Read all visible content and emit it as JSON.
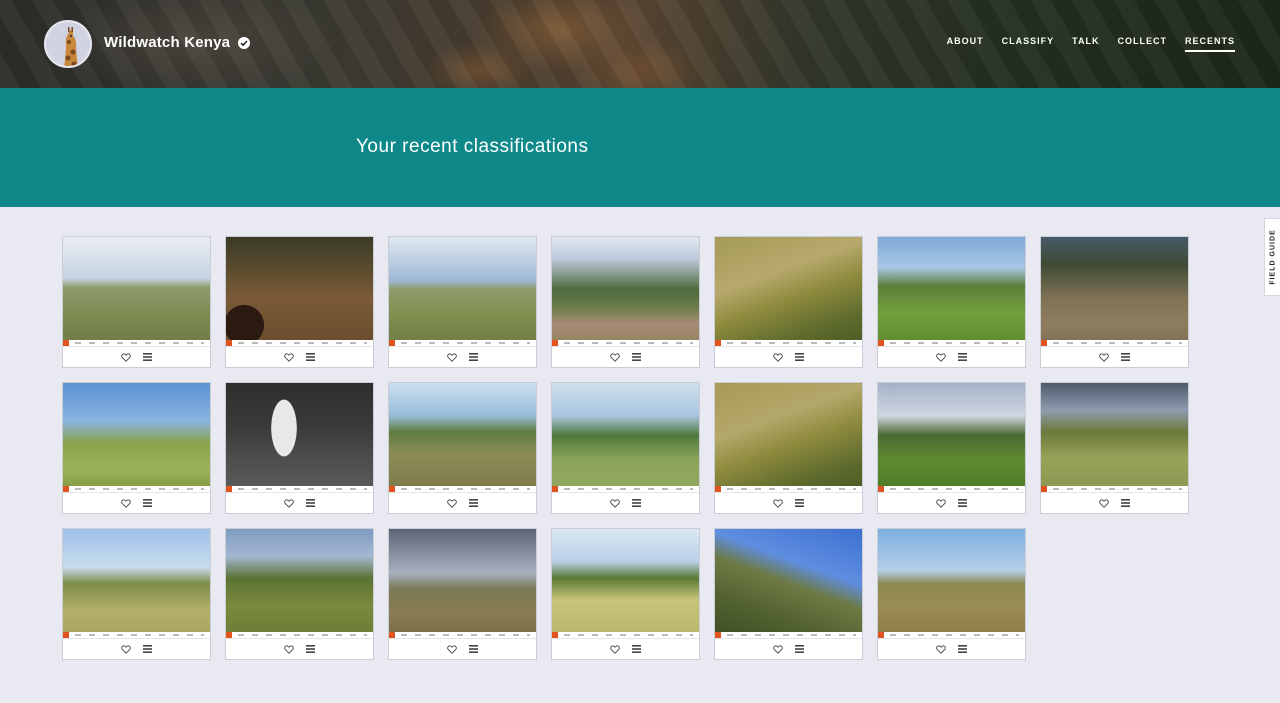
{
  "header": {
    "project_name": "Wildwatch Kenya",
    "nav": [
      {
        "label": "ABOUT",
        "active": false
      },
      {
        "label": "CLASSIFY",
        "active": false
      },
      {
        "label": "TALK",
        "active": false
      },
      {
        "label": "COLLECT",
        "active": false
      },
      {
        "label": "RECENTS",
        "active": true
      }
    ]
  },
  "page": {
    "title": "Your recent classifications"
  },
  "field_guide": {
    "label": "FIELD GUIDE"
  },
  "classifications": [
    {
      "scene": "s1",
      "subject": "open grassland, cloudy sky"
    },
    {
      "scene": "s2",
      "subject": "goats on dirt slope"
    },
    {
      "scene": "s3",
      "subject": "grassland with clouds"
    },
    {
      "scene": "s4",
      "subject": "acacia trees, red soil"
    },
    {
      "scene": "s5",
      "subject": "dry grass close-up"
    },
    {
      "scene": "s6",
      "subject": "green bush, blue sky"
    },
    {
      "scene": "s7",
      "subject": "scrubland dusk"
    },
    {
      "scene": "s8",
      "subject": "green hillside"
    },
    {
      "scene": "s9",
      "subject": "zebra at night"
    },
    {
      "scene": "s10",
      "subject": "savanna with trees"
    },
    {
      "scene": "s11",
      "subject": "grazing animals"
    },
    {
      "scene": "s12",
      "subject": "dry grass close-up"
    },
    {
      "scene": "s13",
      "subject": "bushes, overcast"
    },
    {
      "scene": "s14",
      "subject": "grassland, dark clouds"
    },
    {
      "scene": "s15",
      "subject": "yellow grassland"
    },
    {
      "scene": "s16",
      "subject": "tall grass field"
    },
    {
      "scene": "s17",
      "subject": "plain, storm clouds"
    },
    {
      "scene": "s18",
      "subject": "open plain, bird overhead"
    },
    {
      "scene": "s19",
      "subject": "tilted hillside"
    },
    {
      "scene": "s20",
      "subject": "flat savanna"
    }
  ],
  "icons": {
    "favorite": "heart-icon",
    "collect": "list-icon",
    "verified": "verified-check-icon"
  },
  "colors": {
    "accent": "#0f888a",
    "background": "#e9eaf1"
  }
}
